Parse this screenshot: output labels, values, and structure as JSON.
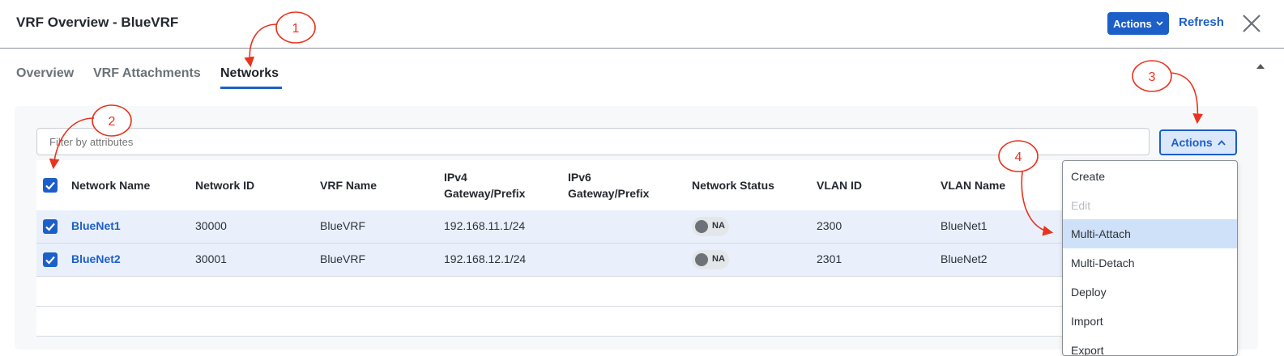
{
  "header": {
    "title": "VRF Overview - BlueVRF",
    "actions_label": "Actions",
    "refresh_label": "Refresh"
  },
  "tabs": [
    {
      "label": "Overview"
    },
    {
      "label": "VRF Attachments"
    },
    {
      "label": "Networks",
      "active": true
    }
  ],
  "toolbar": {
    "filter_placeholder": "Filter by attributes",
    "actions_label": "Actions"
  },
  "table": {
    "columns": [
      "Network Name",
      "Network ID",
      "VRF Name",
      "IPv4",
      "Gateway/Prefix",
      "IPv6",
      "Gateway/Prefix",
      "Network Status",
      "VLAN ID",
      "VLAN Name"
    ],
    "rows": [
      {
        "name": "BlueNet1",
        "id": "30000",
        "vrf": "BlueVRF",
        "ipv4": "192.168.11.1/24",
        "ipv6": "",
        "status": "NA",
        "vlan_id": "2300",
        "vlan_name": "BlueNet1",
        "checked": true
      },
      {
        "name": "BlueNet2",
        "id": "30001",
        "vrf": "BlueVRF",
        "ipv4": "192.168.12.1/24",
        "ipv6": "",
        "status": "NA",
        "vlan_id": "2301",
        "vlan_name": "BlueNet2",
        "checked": true
      }
    ]
  },
  "menu": {
    "items": [
      {
        "label": "Create",
        "state": "enabled"
      },
      {
        "label": "Edit",
        "state": "disabled"
      },
      {
        "label": "Multi-Attach",
        "state": "highlighted"
      },
      {
        "label": "Multi-Detach",
        "state": "enabled"
      },
      {
        "label": "Deploy",
        "state": "enabled"
      },
      {
        "label": "Import",
        "state": "enabled"
      },
      {
        "label": "Export",
        "state": "enabled"
      }
    ]
  },
  "annotations": [
    "1",
    "2",
    "3",
    "4"
  ],
  "colors": {
    "accent": "#1d5fc9",
    "annotation": "#e8341f",
    "row_selected": "#e9f0fb",
    "menu_highlight": "#cfe0f9"
  }
}
